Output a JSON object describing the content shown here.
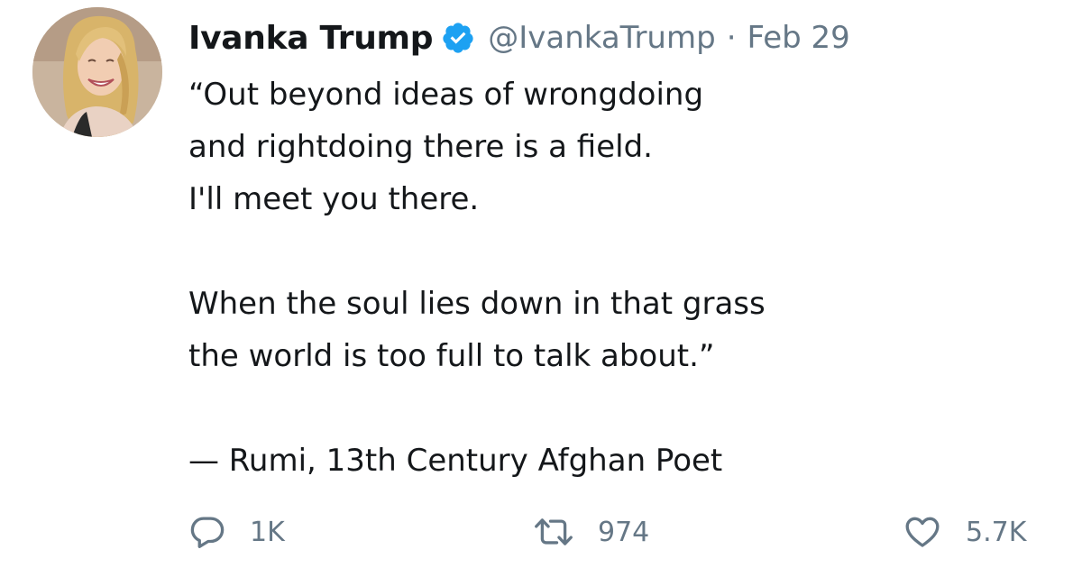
{
  "tweet": {
    "display_name": "Ivanka Trump",
    "verified": true,
    "handle": "@IvankaTrump",
    "separator": "·",
    "date": "Feb 29",
    "text": "“Out beyond ideas of wrongdoing\nand rightdoing there is a field.\nI'll meet you there.\n\nWhen the soul lies down in that grass\nthe world is too full to talk about.”\n\n— Rumi, 13th Century Afghan Poet",
    "reply_count": "1K",
    "retweet_count": "974",
    "like_count": "5.7K"
  },
  "colors": {
    "text": "#14171a",
    "secondary": "#657786",
    "verified": "#1da1f2",
    "background": "#ffffff"
  },
  "icons": {
    "verified": "verified-badge-icon",
    "reply": "reply-bubble-icon",
    "retweet": "retweet-arrows-icon",
    "like": "heart-icon"
  }
}
